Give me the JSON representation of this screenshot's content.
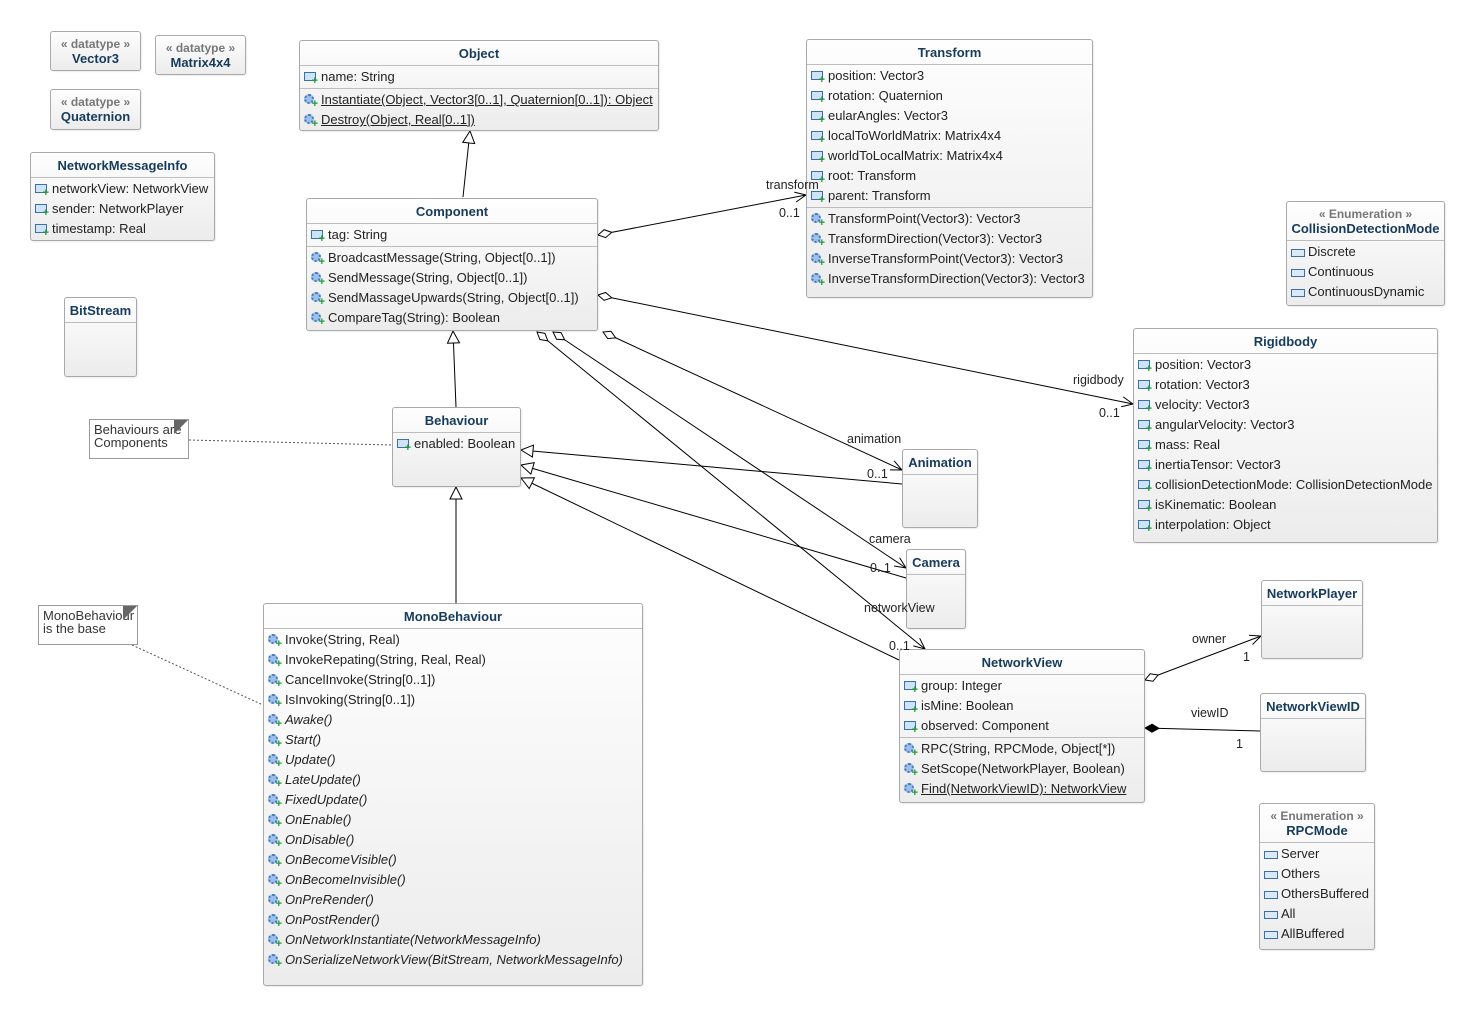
{
  "classes": [
    {
      "id": "vector3",
      "name": "Vector3",
      "stereotype": "« datatype »"
    },
    {
      "id": "matrix4x4",
      "name": "Matrix4x4",
      "stereotype": "« datatype »"
    },
    {
      "id": "quaternion",
      "name": "Quaternion",
      "stereotype": "« datatype »"
    },
    {
      "id": "networkmessageinfo",
      "name": "NetworkMessageInfo",
      "attributes": [
        {
          "text": "networkView: NetworkView"
        },
        {
          "text": "sender: NetworkPlayer"
        },
        {
          "text": "timestamp: Real"
        }
      ]
    },
    {
      "id": "bitstream",
      "name": "BitStream",
      "empty": true
    },
    {
      "id": "object",
      "name": "Object",
      "attributes": [
        {
          "text": "name: String"
        }
      ],
      "operations": [
        {
          "text": "Instantiate(Object, Vector3[0..1], Quaternion[0..1]): Object",
          "static": true
        },
        {
          "text": "Destroy(Object, Real[0..1])",
          "static": true
        }
      ]
    },
    {
      "id": "transform",
      "name": "Transform",
      "attributes": [
        {
          "text": "position: Vector3"
        },
        {
          "text": "rotation: Quaternion"
        },
        {
          "text": "eularAngles: Vector3"
        },
        {
          "text": "localToWorldMatrix: Matrix4x4"
        },
        {
          "text": "worldToLocalMatrix: Matrix4x4"
        },
        {
          "text": "root: Transform"
        },
        {
          "text": "parent: Transform"
        }
      ],
      "operations": [
        {
          "text": "TransformPoint(Vector3): Vector3"
        },
        {
          "text": "TransformDirection(Vector3): Vector3"
        },
        {
          "text": "InverseTransformPoint(Vector3): Vector3"
        },
        {
          "text": "InverseTransformDirection(Vector3): Vector3"
        }
      ]
    },
    {
      "id": "component",
      "name": "Component",
      "attributes": [
        {
          "text": "tag: String"
        }
      ],
      "operations": [
        {
          "text": "BroadcastMessage(String, Object[0..1])"
        },
        {
          "text": "SendMessage(String, Object[0..1])"
        },
        {
          "text": "SendMassageUpwards(String, Object[0..1])"
        },
        {
          "text": "CompareTag(String): Boolean"
        }
      ]
    },
    {
      "id": "collisiondetectionmode",
      "name": "CollisionDetectionMode",
      "stereotype": "« Enumeration »",
      "literals": [
        "Discrete",
        "Continuous",
        "ContinuousDynamic"
      ]
    },
    {
      "id": "rigidbody",
      "name": "Rigidbody",
      "attributes": [
        {
          "text": "position: Vector3"
        },
        {
          "text": "rotation: Vector3"
        },
        {
          "text": "velocity: Vector3"
        },
        {
          "text": "angularVelocity: Vector3"
        },
        {
          "text": "mass: Real"
        },
        {
          "text": "inertiaTensor: Vector3"
        },
        {
          "text": "collisionDetectionMode: CollisionDetectionMode"
        },
        {
          "text": "isKinematic: Boolean"
        },
        {
          "text": "interpolation: Object"
        }
      ]
    },
    {
      "id": "behaviour",
      "name": "Behaviour",
      "attributes": [
        {
          "text": "enabled: Boolean"
        }
      ]
    },
    {
      "id": "animation",
      "name": "Animation",
      "empty": true
    },
    {
      "id": "camera",
      "name": "Camera",
      "empty": true
    },
    {
      "id": "networkplayer",
      "name": "NetworkPlayer",
      "empty": true
    },
    {
      "id": "networkview",
      "name": "NetworkView",
      "attributes": [
        {
          "text": "group: Integer"
        },
        {
          "text": "isMine: Boolean"
        },
        {
          "text": "observed: Component"
        }
      ],
      "operations": [
        {
          "text": "RPC(String, RPCMode, Object[*])"
        },
        {
          "text": "SetScope(NetworkPlayer, Boolean)"
        },
        {
          "text": "Find(NetworkViewID): NetworkView",
          "static": true
        }
      ]
    },
    {
      "id": "networkviewid",
      "name": "NetworkViewID",
      "empty": true
    },
    {
      "id": "rpcmode",
      "name": "RPCMode",
      "stereotype": "« Enumeration »",
      "literals": [
        "Server",
        "Others",
        "OthersBuffered",
        "All",
        "AllBuffered"
      ]
    },
    {
      "id": "monobehaviour",
      "name": "MonoBehaviour",
      "operations": [
        {
          "text": "Invoke(String, Real)"
        },
        {
          "text": "InvokeRepating(String, Real, Real)"
        },
        {
          "text": "CancelInvoke(String[0..1])"
        },
        {
          "text": "IsInvoking(String[0..1])"
        },
        {
          "text": "Awake()",
          "abstract": true
        },
        {
          "text": "Start()",
          "abstract": true
        },
        {
          "text": "Update()",
          "abstract": true
        },
        {
          "text": "LateUpdate()",
          "abstract": true
        },
        {
          "text": "FixedUpdate()",
          "abstract": true
        },
        {
          "text": "OnEnable()",
          "abstract": true
        },
        {
          "text": "OnDisable()",
          "abstract": true
        },
        {
          "text": "OnBecomeVisible()",
          "abstract": true
        },
        {
          "text": "OnBecomeInvisible()",
          "abstract": true
        },
        {
          "text": "OnPreRender()",
          "abstract": true
        },
        {
          "text": "OnPostRender()",
          "abstract": true
        },
        {
          "text": "OnNetworkInstantiate(NetworkMessageInfo)",
          "abstract": true
        },
        {
          "text": "OnSerializeNetworkView(BitStream, NetworkMessageInfo)",
          "abstract": true
        }
      ]
    }
  ],
  "notes": [
    {
      "id": "note-behaviours",
      "text": "Behaviours are Components"
    },
    {
      "id": "note-monobehaviour",
      "text": "MonoBehaviour is the base"
    }
  ],
  "relations": [
    {
      "id": "gen-component-object",
      "kind": "generalization",
      "from": "component",
      "to": "object"
    },
    {
      "id": "gen-behaviour-component",
      "kind": "generalization",
      "from": "behaviour",
      "to": "component"
    },
    {
      "id": "gen-monobehaviour-behaviour",
      "kind": "generalization",
      "from": "monobehaviour",
      "to": "behaviour"
    },
    {
      "id": "gen-animation-behaviour",
      "kind": "generalization",
      "from": "animation",
      "to": "behaviour"
    },
    {
      "id": "gen-camera-behaviour",
      "kind": "generalization",
      "from": "camera",
      "to": "behaviour"
    },
    {
      "id": "gen-networkview-behaviour",
      "kind": "generalization",
      "from": "networkview",
      "to": "behaviour"
    },
    {
      "id": "assoc-transform",
      "kind": "aggregation",
      "from": "component",
      "to": "transform",
      "role": "transform",
      "multiplicity": "0..1"
    },
    {
      "id": "assoc-rigidbody",
      "kind": "aggregation",
      "from": "component",
      "to": "rigidbody",
      "role": "rigidbody",
      "multiplicity": "0..1"
    },
    {
      "id": "assoc-animation",
      "kind": "aggregation",
      "from": "component",
      "to": "animation",
      "role": "animation",
      "multiplicity": "0..1"
    },
    {
      "id": "assoc-camera",
      "kind": "aggregation",
      "from": "component",
      "to": "camera",
      "role": "camera",
      "multiplicity": "0..1"
    },
    {
      "id": "assoc-networkview",
      "kind": "aggregation",
      "from": "component",
      "to": "networkview",
      "role": "networkView",
      "multiplicity": "0..1"
    },
    {
      "id": "assoc-owner",
      "kind": "aggregation",
      "from": "networkview",
      "to": "networkplayer",
      "role": "owner",
      "multiplicity": "1"
    },
    {
      "id": "assoc-viewid",
      "kind": "composition",
      "from": "networkview",
      "to": "networkviewid",
      "role": "viewID",
      "multiplicity": "1"
    },
    {
      "id": "note-link-behaviours",
      "kind": "note-link",
      "from": "note-behaviours",
      "to": "behaviour"
    },
    {
      "id": "note-link-monobehaviour",
      "kind": "note-link",
      "from": "note-monobehaviour",
      "to": "monobehaviour"
    }
  ],
  "colors": {
    "class_name": "#163b5c",
    "border": "#a9a9a9",
    "line": "#000000"
  }
}
